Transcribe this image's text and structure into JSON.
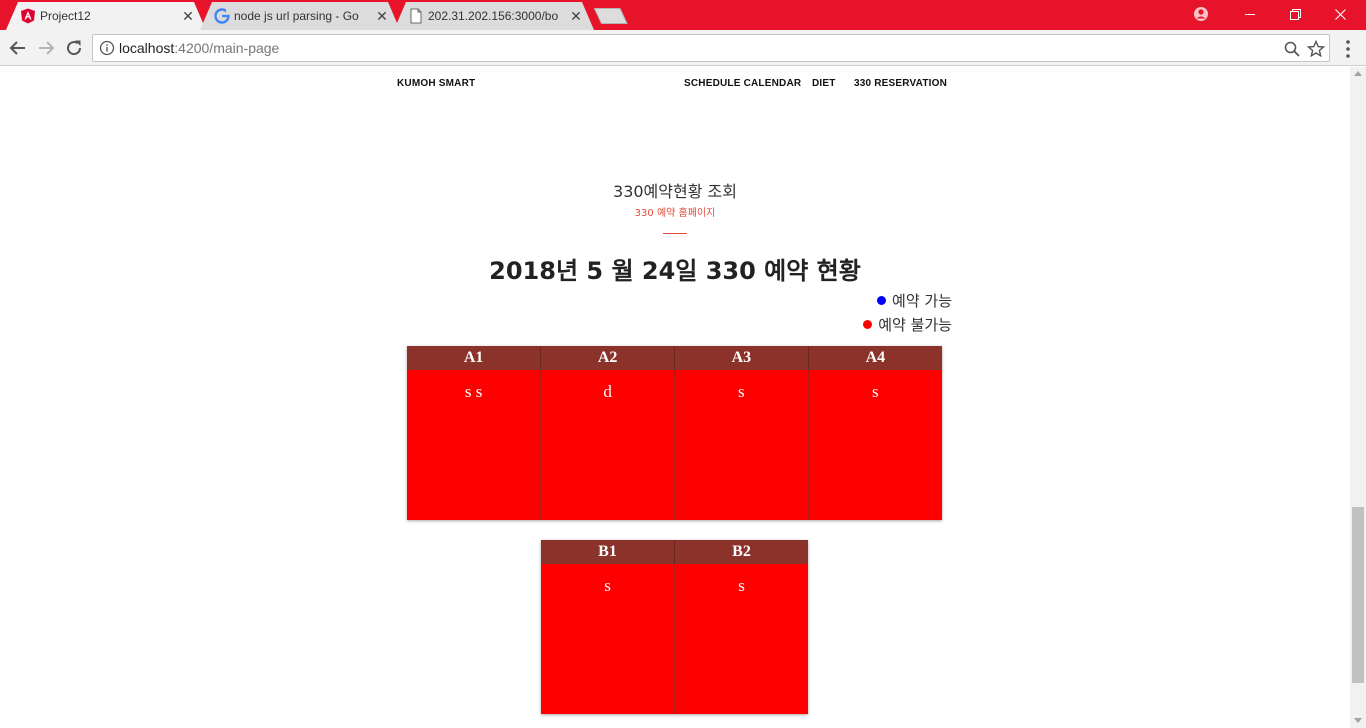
{
  "browser": {
    "tabs": [
      {
        "title": "Project12",
        "icon": "angular-icon",
        "active": true
      },
      {
        "title": "node js url parsing - Go",
        "icon": "google-icon",
        "active": false
      },
      {
        "title": "202.31.202.156:3000/bo",
        "icon": "document-icon",
        "active": false
      }
    ],
    "url_host": "localhost",
    "url_path": ":4200/main-page",
    "accent_color": "#e7132a"
  },
  "nav": {
    "brand": "KUMOH SMART",
    "links": [
      "SCHEDULE CALENDAR",
      "DIET",
      "330 RESERVATION"
    ]
  },
  "section": {
    "title": "330예약현황 조회",
    "subtitle": "330 예약 홈페이지"
  },
  "heading": "2018년 5 월 24일 330 예약 현황",
  "legend": [
    {
      "label": "예약 가능",
      "color": "#0000ff"
    },
    {
      "label": "예약 불가능",
      "color": "#ff0000"
    }
  ],
  "tables": [
    {
      "headers": [
        "A1",
        "A2",
        "A3",
        "A4"
      ],
      "values": [
        "s s",
        "d",
        "s",
        "s"
      ]
    },
    {
      "headers": [
        "B1",
        "B2"
      ],
      "values": [
        "s",
        "s"
      ]
    }
  ]
}
